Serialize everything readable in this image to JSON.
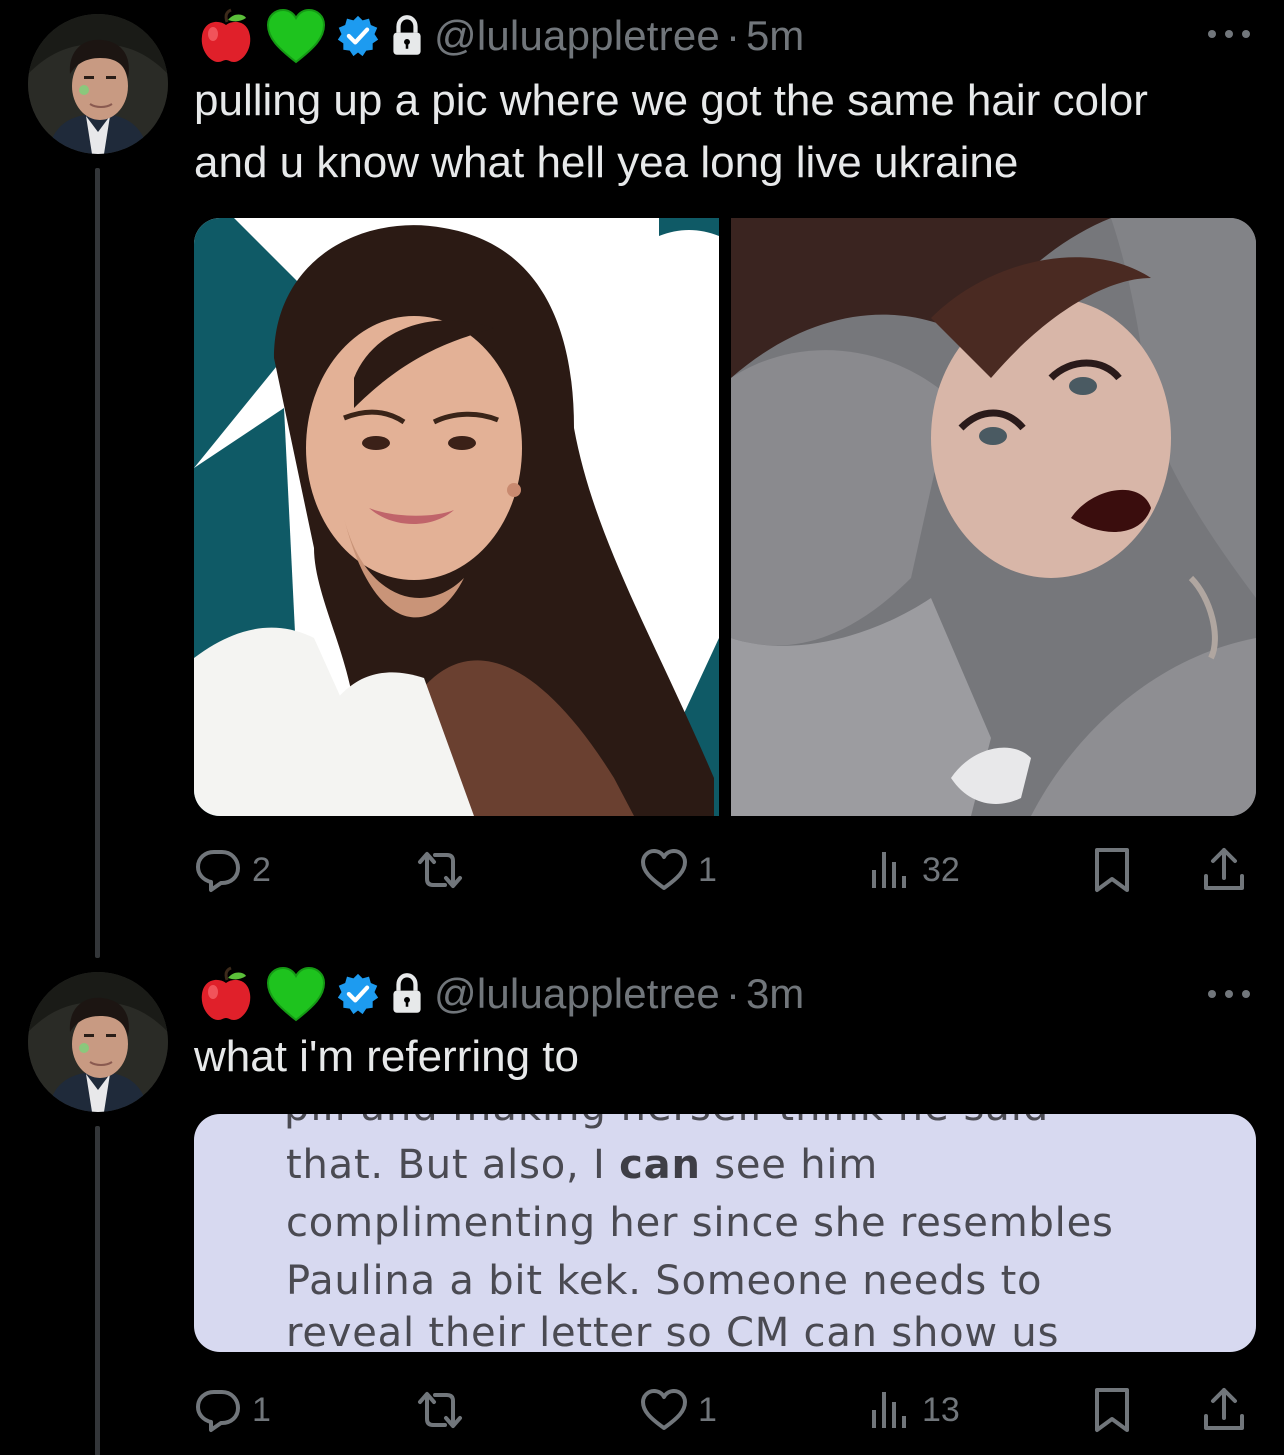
{
  "tweets": [
    {
      "emojis": [
        "red-apple-emoji",
        "green-heart-emoji"
      ],
      "handle": "@luluappletree",
      "separator": "·",
      "time": "5m",
      "text_lines": [
        "pulling up a pic where we got the same hair color",
        "and u know what hell yea long live ukraine"
      ],
      "stats": {
        "replies": "2",
        "retweets": "",
        "likes": "1",
        "views": "32"
      }
    },
    {
      "emojis": [
        "red-apple-emoji",
        "green-heart-emoji"
      ],
      "handle": "@luluappletree",
      "separator": "·",
      "time": "3m",
      "text_lines": [
        "what i'm referring to"
      ],
      "quoted": {
        "cut_top": "pill and making herself think he said",
        "line1_pre": "that. But also, I ",
        "line1_bold": "can",
        "line1_post": " see him",
        "line2": "complimenting her since she resembles",
        "line3": "Paulina a bit kek. Someone needs to",
        "line4": "reveal their letter so CM can show us"
      },
      "stats": {
        "replies": "1",
        "retweets": "",
        "likes": "1",
        "views": "13"
      }
    }
  ],
  "colors": {
    "background": "#000000",
    "text": "#e7e9ea",
    "muted": "#71767b",
    "verified": "#1d9bf0",
    "card": "#d7d9f0"
  }
}
